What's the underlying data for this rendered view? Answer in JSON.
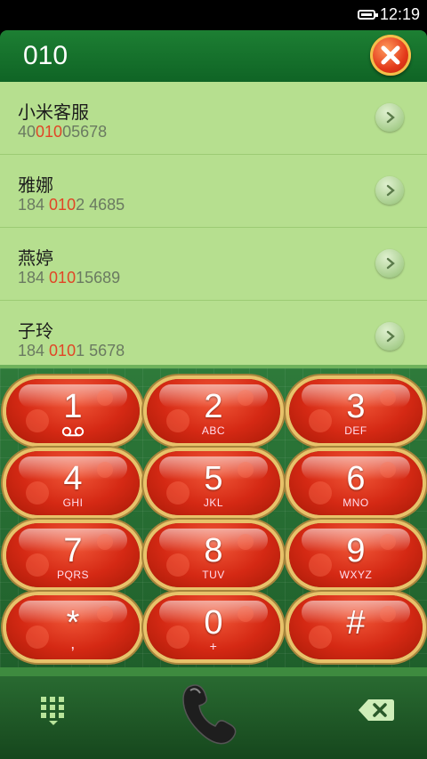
{
  "status": {
    "time": "12:19"
  },
  "header": {
    "dialed": "010"
  },
  "contacts": [
    {
      "name": "小米客服",
      "pre": "40",
      "match": "010",
      "post": "05678"
    },
    {
      "name": "雅娜",
      "pre": "184 ",
      "match": "010",
      "post": "2 4685"
    },
    {
      "name": "燕婷",
      "pre": "184 ",
      "match": "010",
      "post": "15689"
    },
    {
      "name": "子玲",
      "pre": "184 ",
      "match": "010",
      "post": "1 5678"
    }
  ],
  "keys": [
    {
      "digit": "1",
      "letters": ""
    },
    {
      "digit": "2",
      "letters": "ABC"
    },
    {
      "digit": "3",
      "letters": "DEF"
    },
    {
      "digit": "4",
      "letters": "GHI"
    },
    {
      "digit": "5",
      "letters": "JKL"
    },
    {
      "digit": "6",
      "letters": "MNO"
    },
    {
      "digit": "7",
      "letters": "PQRS"
    },
    {
      "digit": "8",
      "letters": "TUV"
    },
    {
      "digit": "9",
      "letters": "WXYZ"
    },
    {
      "digit": "*",
      "letters": ","
    },
    {
      "digit": "0",
      "letters": "+"
    },
    {
      "digit": "#",
      "letters": ""
    }
  ],
  "colors": {
    "header_green": "#0f6425",
    "list_bg": "#b6df8f",
    "match_highlight": "#e14526",
    "key_red": "#d52914"
  },
  "icons": {
    "voicemail": "voicemail-icon",
    "close": "close-icon",
    "dialpad": "dialpad-icon",
    "call": "phone-handset-icon",
    "backspace": "backspace-icon"
  }
}
